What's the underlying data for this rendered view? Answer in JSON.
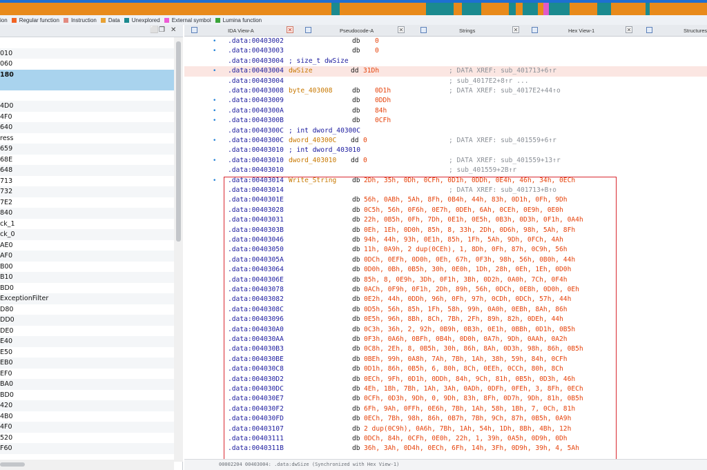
{
  "navband": {
    "colors": {
      "blue": "#1e6fd2",
      "orange": "#e88a1b",
      "teal": "#1b8a8f",
      "pink": "#e05ac8",
      "grey": "#9aa3ad"
    },
    "segments": [
      [
        "orange",
        480
      ],
      [
        "teal",
        12
      ],
      [
        "orange",
        125
      ],
      [
        "teal",
        40
      ],
      [
        "orange",
        12
      ],
      [
        "teal",
        28
      ],
      [
        "orange",
        40
      ],
      [
        "teal",
        10
      ],
      [
        "orange",
        10
      ],
      [
        "teal",
        22
      ],
      [
        "orange",
        8
      ],
      [
        "pink",
        8
      ],
      [
        "teal",
        30
      ],
      [
        "orange",
        40
      ],
      [
        "teal",
        20
      ],
      [
        "orange",
        50
      ],
      [
        "teal",
        6
      ],
      [
        "orange",
        83
      ]
    ]
  },
  "legend": [
    {
      "label": "ion",
      "color": "#2f66c7",
      "partial": true
    },
    {
      "label": "Regular function",
      "color": "#f26322"
    },
    {
      "label": "Instruction",
      "color": "#e38a80"
    },
    {
      "label": "Data",
      "color": "#e8a234"
    },
    {
      "label": "Unexplored",
      "color": "#1b8a8f"
    },
    {
      "label": "External symbol",
      "color": "#ee5bd6"
    },
    {
      "label": "Lumina function",
      "color": "#3aa43a"
    }
  ],
  "left_pane": {
    "header_buttons": [
      "⬜",
      "❐",
      "✕"
    ],
    "rows": [
      "",
      "010",
      "060",
      "180",
      "",
      "4D0",
      "4F0",
      "640",
      "ress",
      "659",
      "68E",
      "648",
      "713",
      "732",
      "7E2",
      "840",
      "ck_1",
      "ck_0",
      "AE0",
      "AF0",
      "B00",
      "B10",
      "BD0",
      "ExceptionFilter",
      "D80",
      "DD0",
      "DE0",
      "E40",
      "E50",
      "EB0",
      "EF0",
      "BA0",
      "BD0",
      "420",
      "4B0",
      "4F0",
      "520",
      "F60"
    ],
    "selected_index": 3
  },
  "tabs": [
    {
      "label": "IDA View-A",
      "active": true
    },
    {
      "label": "Pseudocode-A",
      "active": false
    },
    {
      "label": "Strings",
      "active": false
    },
    {
      "label": "Hex View-1",
      "active": false
    },
    {
      "label": "Structures",
      "active": false
    }
  ],
  "disasm": [
    {
      "dot": true,
      "seg": ".data:00403002",
      "mn": "db",
      "ops": "0"
    },
    {
      "dot": true,
      "seg": ".data:00403003",
      "mn": "db",
      "ops": "0"
    },
    {
      "dot": false,
      "seg": ".data:00403004",
      "type": "; size_t dwSize"
    },
    {
      "dot": true,
      "seg": ".data:00403004",
      "label": "dwSize",
      "mn": "dd",
      "ops": "31Dh",
      "xref": "; DATA XREF: sub_401713+6↑r",
      "highlight": true
    },
    {
      "dot": false,
      "seg": ".data:00403004",
      "xref": "; sub_4017E2+8↑r ..."
    },
    {
      "dot": false,
      "seg": ".data:00403008",
      "label": "byte_403008",
      "mn": "db",
      "ops": "0D1h",
      "xref": "; DATA XREF: sub_4017E2+44↑o"
    },
    {
      "dot": true,
      "seg": ".data:00403009",
      "mn": "db",
      "ops": "0DDh"
    },
    {
      "dot": true,
      "seg": ".data:0040300A",
      "mn": "db",
      "ops": "84h"
    },
    {
      "dot": true,
      "seg": ".data:0040300B",
      "mn": "db",
      "ops": "0CFh"
    },
    {
      "dot": false,
      "seg": ".data:0040300C",
      "type": "; int dword_40300C"
    },
    {
      "dot": true,
      "seg": ".data:0040300C",
      "label": "dword_40300C",
      "mn": "dd",
      "ops": "0",
      "xref": "; DATA XREF: sub_401559+6↑r"
    },
    {
      "dot": false,
      "seg": ".data:00403010",
      "type": "; int dword_403010"
    },
    {
      "dot": true,
      "seg": ".data:00403010",
      "label": "dword_403010",
      "mn": "dd",
      "ops": "0",
      "xref": "; DATA XREF: sub_401559+13↑r"
    },
    {
      "dot": false,
      "seg": ".data:00403010",
      "xref": "; sub_401559+2B↑r"
    },
    {
      "dot": true,
      "seg": ".data:00403014",
      "label": "Write_String",
      "mn": "db",
      "ops": "2Dh, 35h, 0Dh, 0CFh, 0D1h, 0DDh, 0E4h, 46h, 34h, 0ECh"
    },
    {
      "dot": false,
      "seg": ".data:00403014",
      "xref": "; DATA XREF: sub_401713+B↑o"
    },
    {
      "dot": false,
      "seg": ".data:0040301E",
      "mn": "db",
      "ops": "56h, 0ABh, 5Ah, 8Fh, 0B4h, 44h, 83h, 0D1h, 0Fh, 9Dh"
    },
    {
      "dot": false,
      "seg": ".data:00403028",
      "mn": "db",
      "ops": "0C5h, 56h, 0F6h, 0E7h, 0DEh, 6Ah, 0CEh, 0E9h, 0E0h"
    },
    {
      "dot": false,
      "seg": ".data:00403031",
      "mn": "db",
      "ops": "22h, 0B5h, 0Fh, 7Dh, 0E1h, 0E5h, 0B3h, 0D3h, 0F1h, 0A4h"
    },
    {
      "dot": false,
      "seg": ".data:0040303B",
      "mn": "db",
      "ops": "0Eh, 1Eh, 0D0h, 85h, 8, 33h, 2Dh, 0D6h, 98h, 5Ah, 8Fh"
    },
    {
      "dot": false,
      "seg": ".data:00403046",
      "mn": "db",
      "ops": "94h, 44h, 93h, 0E1h, 85h, 1Fh, 5Ah, 9Dh, 0FCh, 4Ah"
    },
    {
      "dot": false,
      "seg": ".data:00403050",
      "mn": "db",
      "ops": "11h, 0A9h, 2 dup(0CEh), 1, 8Dh, 0Fh, 87h, 0C9h, 56h"
    },
    {
      "dot": false,
      "seg": ".data:0040305A",
      "mn": "db",
      "ops": "0DCh, 0EFh, 0D0h, 0Eh, 67h, 0F3h, 98h, 56h, 0B0h, 44h"
    },
    {
      "dot": false,
      "seg": ".data:00403064",
      "mn": "db",
      "ops": "0D0h, 0Bh, 0B5h, 30h, 0E0h, 1Dh, 28h, 0Eh, 1Eh, 0D0h"
    },
    {
      "dot": false,
      "seg": ".data:0040306E",
      "mn": "db",
      "ops": "85h, 8, 0E9h, 3Dh, 0F1h, 3Bh, 0D2h, 0A0h, 7Ch, 0F4h"
    },
    {
      "dot": false,
      "seg": ".data:00403078",
      "mn": "db",
      "ops": "0ACh, 0F9h, 0F1h, 2Dh, 89h, 56h, 0DCh, 0EBh, 0D0h, 0Eh"
    },
    {
      "dot": false,
      "seg": ".data:00403082",
      "mn": "db",
      "ops": "0E2h, 44h, 0DDh, 96h, 0Fh, 97h, 0CDh, 0DCh, 57h, 44h"
    },
    {
      "dot": false,
      "seg": ".data:0040308C",
      "mn": "db",
      "ops": "0D5h, 56h, 85h, 1Fh, 58h, 99h, 0A0h, 0EBh, 8Ah, 86h"
    },
    {
      "dot": false,
      "seg": ".data:00403096",
      "mn": "db",
      "ops": "0E5h, 96h, 8Bh, 8Ch, 7Bh, 2Fh, 89h, 82h, 0DEh, 44h"
    },
    {
      "dot": false,
      "seg": ".data:004030A0",
      "mn": "db",
      "ops": "0C3h, 36h, 2, 92h, 0B9h, 0B3h, 0E1h, 0BBh, 0D1h, 0B5h"
    },
    {
      "dot": false,
      "seg": ".data:004030AA",
      "mn": "db",
      "ops": "0F3h, 0A6h, 0BFh, 0B4h, 0D0h, 0A7h, 9Dh, 0AAh, 0A2h"
    },
    {
      "dot": false,
      "seg": ".data:004030B3",
      "mn": "db",
      "ops": "0C8h, 2Eh, 8, 0B5h, 30h, 86h, 8Ah, 0D3h, 98h, 86h, 0B5h"
    },
    {
      "dot": false,
      "seg": ".data:004030BE",
      "mn": "db",
      "ops": "0BEh, 99h, 0A8h, 7Ah, 7Bh, 1Ah, 38h, 59h, 84h, 0CFh"
    },
    {
      "dot": false,
      "seg": ".data:004030C8",
      "mn": "db",
      "ops": "0D1h, 86h, 0B5h, 6, 80h, 8Ch, 0EEh, 0CCh, 80h, 8Ch"
    },
    {
      "dot": false,
      "seg": ".data:004030D2",
      "mn": "db",
      "ops": "0ECh, 9Fh, 0D1h, 0DDh, 84h, 9Ch, 81h, 0B5h, 0D3h, 46h"
    },
    {
      "dot": false,
      "seg": ".data:004030DC",
      "mn": "db",
      "ops": "4Eh, 1Bh, 7Bh, 1Ah, 3Ah, 0ADh, 0DFh, 0FEh, 3, 8Fh, 0ECh"
    },
    {
      "dot": false,
      "seg": ".data:004030E7",
      "mn": "db",
      "ops": "0CFh, 0D3h, 9Dh, 0, 9Dh, 83h, 8Fh, 0D7h, 9Dh, 81h, 0B5h"
    },
    {
      "dot": false,
      "seg": ".data:004030F2",
      "mn": "db",
      "ops": "6Fh, 9Ah, 0FFh, 0E6h, 7Bh, 1Ah, 58h, 1Bh, 7, 0Ch, 81h"
    },
    {
      "dot": false,
      "seg": ".data:004030FD",
      "mn": "db",
      "ops": "0ECh, 7Bh, 98h, 86h, 0B7h, 7Bh, 9Ch, 87h, 0B5h, 0A9h"
    },
    {
      "dot": false,
      "seg": ".data:00403107",
      "mn": "db",
      "ops": "2 dup(0C9h), 0A6h, 7Bh, 1Ah, 54h, 1Dh, 8Bh, 4Bh, 12h"
    },
    {
      "dot": false,
      "seg": ".data:00403111",
      "mn": "db",
      "ops": "0DCh, 84h, 0CFh, 0E0h, 22h, 1, 39h, 0A5h, 0D9h, 0Dh"
    },
    {
      "dot": false,
      "seg": ".data:0040311B",
      "mn": "db",
      "ops": "36h, 3Ah, 0D4h, 0ECh, 6Fh, 14h, 3Fh, 0D9h, 39h, 4, 5Ah"
    }
  ],
  "status_bar": "00002204 00403004: .data:dwSize (Synchronized with Hex View-1)"
}
